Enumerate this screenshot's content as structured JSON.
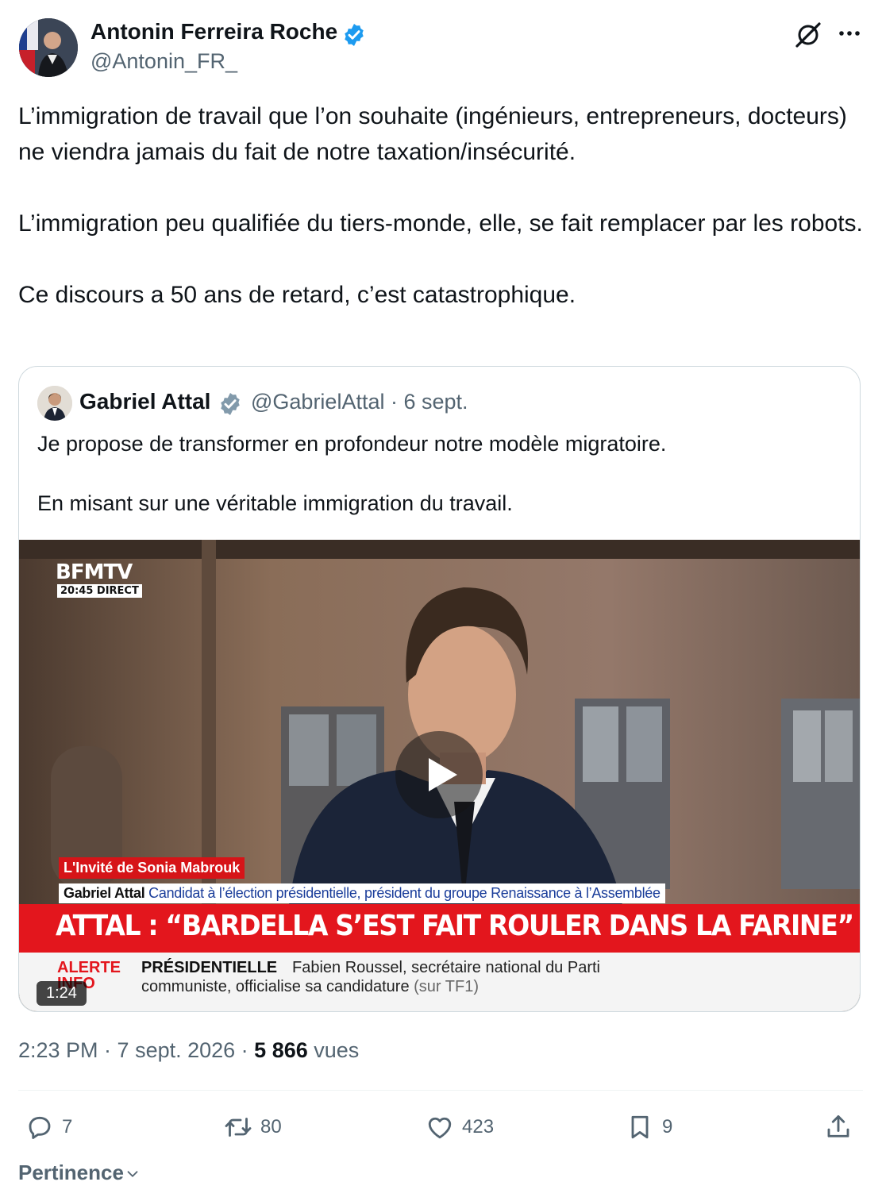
{
  "author": {
    "name": "Antonin Ferreira Roche",
    "handle": "@Antonin_FR_",
    "verified": true
  },
  "tweet": {
    "paragraphs": [
      "L’immigration de travail que l’on souhaite (ingénieurs, entrepreneurs, docteurs) ne viendra jamais du fait de notre taxation/insécurité.",
      "L’immigration peu qualifiée du tiers-monde, elle, se fait remplacer par les robots.",
      "Ce discours a 50 ans de retard, c’est catastrophique."
    ]
  },
  "quote": {
    "name": "Gabriel Attal",
    "meta": "@GabrielAttal · 6 sept.",
    "paragraphs": [
      "Je propose de transformer en profondeur notre modèle migratoire.",
      "En misant sur une véritable immigration du travail."
    ],
    "video": {
      "channel_logo": "BFMTV",
      "channel_time": "20:45 DIRECT",
      "show_label": "L'Invité de Sonia Mabrouk",
      "guest_name": "Gabriel Attal",
      "guest_role": "Candidat à l’élection présidentielle, président du groupe Renaissance à l’Assemblée",
      "headline": "ATTAL : “BARDELLA S’EST FAIT ROULER DANS LA FARINE”",
      "alert_label_1": "ALERTE",
      "alert_label_2": "INFO",
      "ticker_topic": "PRÉSIDENTIELLE",
      "ticker_line1": "Fabien Roussel, secrétaire national du Parti",
      "ticker_line2": "communiste, officialise sa candidature",
      "ticker_source": "(sur TF1)",
      "duration": "1:24"
    }
  },
  "footer": {
    "time": "2:23 PM · 7 sept. 2026 · ",
    "views_count": "5 866",
    "views_label": " vues"
  },
  "actions": {
    "replies": "7",
    "retweets": "80",
    "likes": "423",
    "bookmarks": "9"
  },
  "sort_label": "Pertinence",
  "colors": {
    "accent": "#1d9bf0",
    "muted": "#536471",
    "bfm_red": "#e3161d"
  }
}
